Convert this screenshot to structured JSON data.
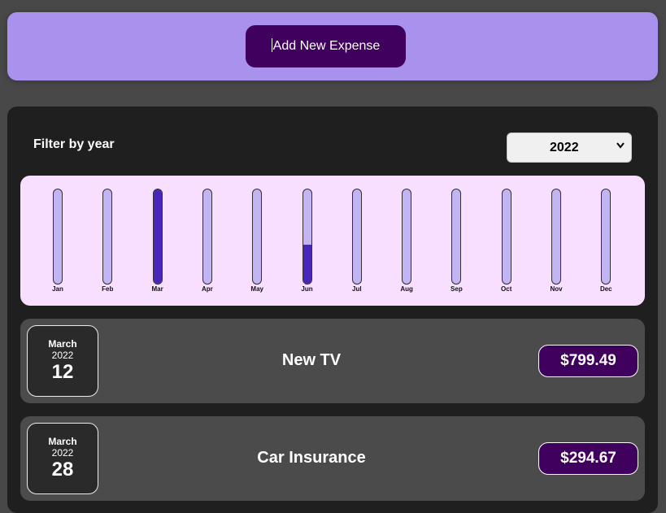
{
  "new_expense": {
    "add_button_label": "Add New Expense"
  },
  "filter": {
    "label": "Filter by year",
    "selected_year": "2022"
  },
  "chart": {
    "months": [
      {
        "label": "Jan",
        "fill": 0
      },
      {
        "label": "Feb",
        "fill": 0
      },
      {
        "label": "Mar",
        "fill": 1.0
      },
      {
        "label": "Apr",
        "fill": 0
      },
      {
        "label": "May",
        "fill": 0
      },
      {
        "label": "Jun",
        "fill": 0.41
      },
      {
        "label": "Jul",
        "fill": 0
      },
      {
        "label": "Aug",
        "fill": 0
      },
      {
        "label": "Sep",
        "fill": 0
      },
      {
        "label": "Oct",
        "fill": 0
      },
      {
        "label": "Nov",
        "fill": 0
      },
      {
        "label": "Dec",
        "fill": 0
      }
    ]
  },
  "expenses": [
    {
      "month": "March",
      "year": "2022",
      "day": "12",
      "title": "New TV",
      "amount": "$799.49"
    },
    {
      "month": "March",
      "year": "2022",
      "day": "28",
      "title": "Car Insurance",
      "amount": "$294.67"
    }
  ],
  "colors": {
    "header_bg": "#a892ee",
    "button_bg": "#40005d",
    "panel_bg": "#1f1f1f",
    "chart_bg": "#f8dfff",
    "bar_empty": "#c3b4f3",
    "bar_fill": "#4826b9",
    "item_bg": "#4b4b4b"
  }
}
